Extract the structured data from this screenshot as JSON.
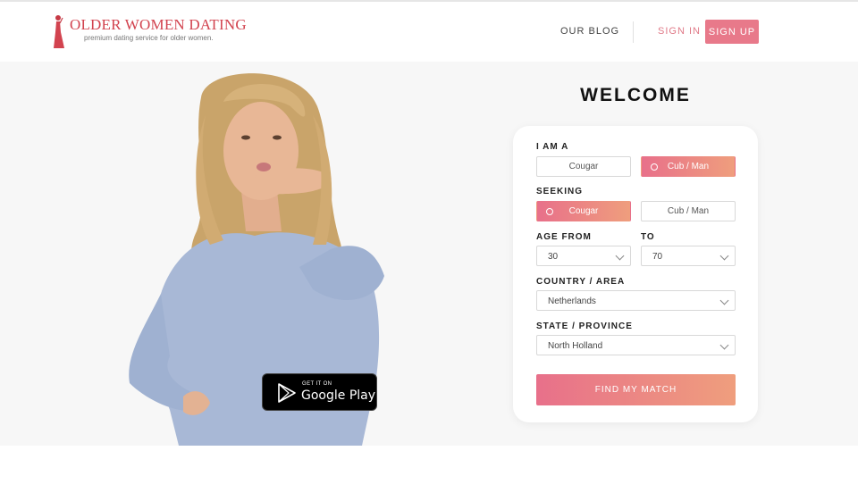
{
  "header": {
    "logo_title": "OLDER WOMEN DATING",
    "logo_tagline": "premium dating service for older women.",
    "nav_blog": "OUR BLOG",
    "nav_signin": "SIGN IN",
    "nav_signup": "SIGN UP"
  },
  "hero": {
    "store_badge_small": "GET IT ON",
    "store_badge_big": "Google Play"
  },
  "form": {
    "title": "WELCOME",
    "i_am_label": "I AM A",
    "i_am_options": [
      "Cougar",
      "Cub / Man"
    ],
    "i_am_selected": "Cub / Man",
    "seeking_label": "SEEKING",
    "seeking_options": [
      "Cougar",
      "Cub / Man"
    ],
    "seeking_selected": "Cougar",
    "age_from_label": "AGE FROM",
    "age_to_label": "TO",
    "age_from_value": "30",
    "age_to_value": "70",
    "country_label": "COUNTRY / AREA",
    "country_value": "Netherlands",
    "state_label": "STATE / PROVINCE",
    "state_value": "North Holland",
    "submit_label": "FIND MY MATCH"
  },
  "colors": {
    "brand_red": "#d2434f",
    "accent_pink": "#e8798a",
    "gradient_start": "#e8708a",
    "gradient_end": "#ef9e7d"
  }
}
